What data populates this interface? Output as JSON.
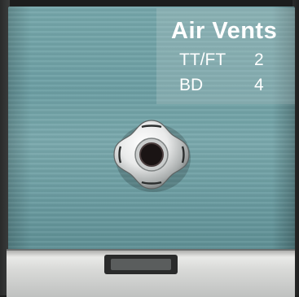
{
  "panel": {
    "title": "Air Vents",
    "rows": [
      {
        "label": "TT/FT",
        "value": "2"
      },
      {
        "label": "BD",
        "value": "4"
      }
    ]
  },
  "colors": {
    "shell": "#76a7ab",
    "rim": "#e6e7e5",
    "panel_text": "#ffffff"
  }
}
